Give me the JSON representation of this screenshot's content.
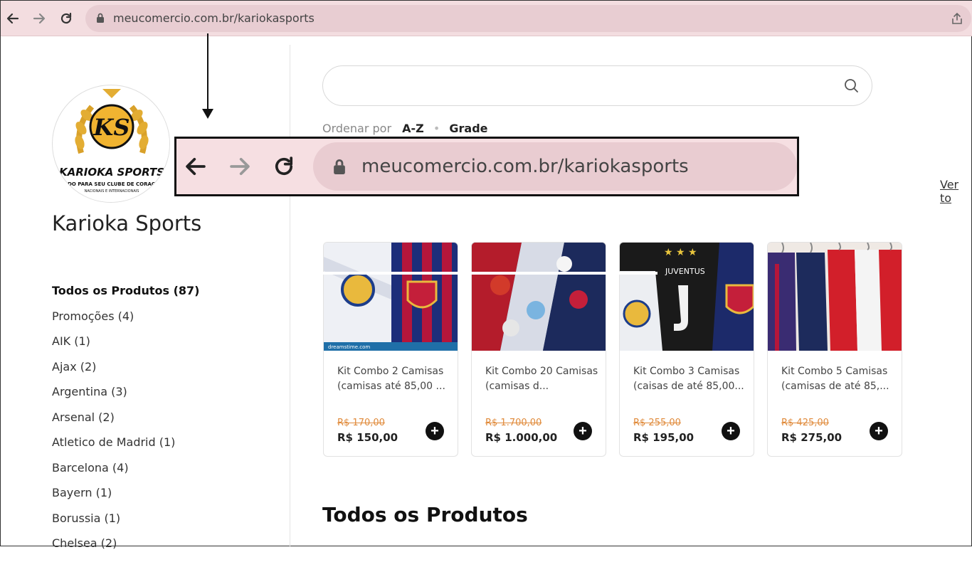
{
  "browser": {
    "url": "meucomercio.com.br/kariokasports"
  },
  "store": {
    "name": "Karioka Sports",
    "logo": {
      "monogram": "KS",
      "brand": "KARIOKA SPORTS",
      "tagline1": "TUDO PARA SEU CLUBE DE CORAÇÃO",
      "tagline2": "NACIONAIS E INTERNACIONAIS"
    }
  },
  "sidebar": {
    "categories": [
      {
        "label": "Todos os Produtos (87)"
      },
      {
        "label": "Promoções (4)"
      },
      {
        "label": "AIK (1)"
      },
      {
        "label": "Ajax (2)"
      },
      {
        "label": "Argentina (3)"
      },
      {
        "label": "Arsenal (2)"
      },
      {
        "label": "Atletico de Madrid (1)"
      },
      {
        "label": "Barcelona (4)"
      },
      {
        "label": "Bayern (1)"
      },
      {
        "label": "Borussia (1)"
      },
      {
        "label": "Chelsea (2)"
      }
    ]
  },
  "search": {
    "placeholder": ""
  },
  "sort": {
    "label": "Ordenar por",
    "order": "A-Z",
    "view": "Grade"
  },
  "promo_section": {
    "see_all": "Ver to"
  },
  "zoom": {
    "url": "meucomercio.com.br/kariokasports"
  },
  "products": [
    {
      "title": "Kit Combo 2 Camisas (camisas até 85,00 ...",
      "old_price": "R$ 170,00",
      "price": "R$ 150,00",
      "image_caption": "dreamstime.com"
    },
    {
      "title": "Kit Combo 20 Camisas (camisas d...",
      "old_price": "R$ 1.700,00",
      "price": "R$ 1.000,00"
    },
    {
      "title": "Kit Combo 3 Camisas (caisas de até 85,00...",
      "old_price": "R$ 255,00",
      "price": "R$ 195,00",
      "image_caption": "JUVENTUS"
    },
    {
      "title": "Kit Combo 5 Camisas (camisas de até 85,...",
      "old_price": "R$ 425,00",
      "price": "R$ 275,00"
    }
  ],
  "all_products": {
    "title": "Todos os Produtos"
  },
  "colors": {
    "topbar": "#f3dde0",
    "url_pill": "#e8cdd2",
    "old_price": "#e08a3a",
    "add_button": "#111111"
  }
}
